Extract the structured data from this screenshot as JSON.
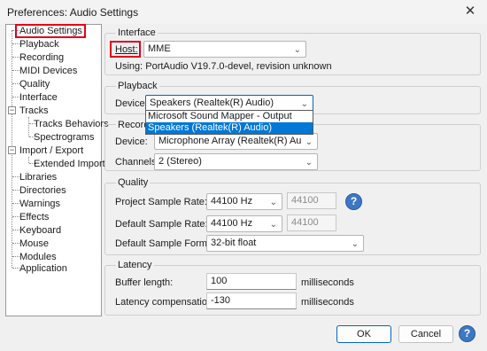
{
  "window": {
    "title": "Preferences: Audio Settings",
    "close_glyph": "✕"
  },
  "tree": {
    "items": [
      {
        "label": "Audio Settings"
      },
      {
        "label": "Playback"
      },
      {
        "label": "Recording"
      },
      {
        "label": "MIDI Devices"
      },
      {
        "label": "Quality"
      },
      {
        "label": "Interface"
      },
      {
        "label": "Tracks"
      },
      {
        "label": "Tracks Behaviors"
      },
      {
        "label": "Spectrograms"
      },
      {
        "label": "Import / Export"
      },
      {
        "label": "Extended Import"
      },
      {
        "label": "Libraries"
      },
      {
        "label": "Directories"
      },
      {
        "label": "Warnings"
      },
      {
        "label": "Effects"
      },
      {
        "label": "Keyboard"
      },
      {
        "label": "Mouse"
      },
      {
        "label": "Modules"
      },
      {
        "label": "Application"
      }
    ],
    "expander_glyph": "−"
  },
  "interface": {
    "group_title": "Interface",
    "host_label": "Host:",
    "host_value": "MME",
    "using_text": "Using: PortAudio V19.7.0-devel, revision unknown"
  },
  "playback": {
    "group_title": "Playback",
    "device_label": "Device:",
    "device_value": "Speakers (Realtek(R) Audio)",
    "dropdown_options": [
      "Microsoft Sound Mapper - Output",
      "Speakers (Realtek(R) Audio)"
    ]
  },
  "recording": {
    "group_title_visible": "Recordi",
    "device_label": "Device:",
    "device_value": "Microphone Array (Realtek(R) Au",
    "channels_label": "Channels:",
    "channels_value": "2 (Stereo)"
  },
  "quality": {
    "group_title": "Quality",
    "project_rate_label": "Project Sample Rate:",
    "project_rate_value": "44100 Hz",
    "project_rate_field": "44100",
    "default_rate_label": "Default Sample Rate:",
    "default_rate_value": "44100 Hz",
    "default_rate_field": "44100",
    "format_label": "Default Sample Format:",
    "format_value": "32-bit float",
    "help_glyph": "?"
  },
  "latency": {
    "group_title": "Latency",
    "buffer_label": "Buffer length:",
    "buffer_value": "100",
    "buffer_unit": "milliseconds",
    "comp_label": "Latency compensation:",
    "comp_value": "-130",
    "comp_unit": "milliseconds"
  },
  "footer": {
    "ok_label": "OK",
    "cancel_label": "Cancel",
    "help_glyph": "?"
  },
  "colors": {
    "highlight": "#e1001c",
    "selection": "#0078d7",
    "help_button": "#3d78c4",
    "focus_border": "#0067c0"
  },
  "icons": {
    "chevron": "chevron-down-icon",
    "help": "help-icon",
    "close": "close-icon"
  }
}
